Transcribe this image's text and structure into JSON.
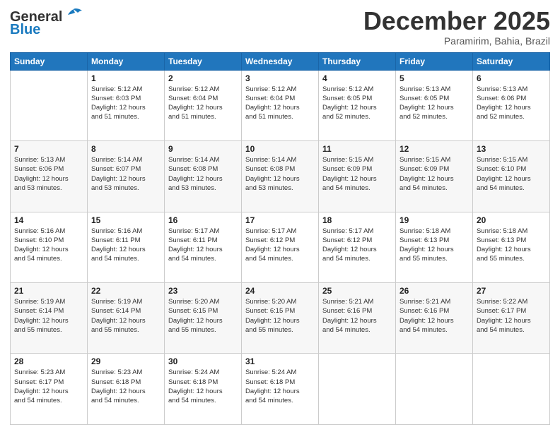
{
  "header": {
    "logo_general": "General",
    "logo_blue": "Blue",
    "month": "December 2025",
    "location": "Paramirim, Bahia, Brazil"
  },
  "weekdays": [
    "Sunday",
    "Monday",
    "Tuesday",
    "Wednesday",
    "Thursday",
    "Friday",
    "Saturday"
  ],
  "weeks": [
    [
      {
        "day": "",
        "info": ""
      },
      {
        "day": "1",
        "info": "Sunrise: 5:12 AM\nSunset: 6:03 PM\nDaylight: 12 hours\nand 51 minutes."
      },
      {
        "day": "2",
        "info": "Sunrise: 5:12 AM\nSunset: 6:04 PM\nDaylight: 12 hours\nand 51 minutes."
      },
      {
        "day": "3",
        "info": "Sunrise: 5:12 AM\nSunset: 6:04 PM\nDaylight: 12 hours\nand 51 minutes."
      },
      {
        "day": "4",
        "info": "Sunrise: 5:12 AM\nSunset: 6:05 PM\nDaylight: 12 hours\nand 52 minutes."
      },
      {
        "day": "5",
        "info": "Sunrise: 5:13 AM\nSunset: 6:05 PM\nDaylight: 12 hours\nand 52 minutes."
      },
      {
        "day": "6",
        "info": "Sunrise: 5:13 AM\nSunset: 6:06 PM\nDaylight: 12 hours\nand 52 minutes."
      }
    ],
    [
      {
        "day": "7",
        "info": "Sunrise: 5:13 AM\nSunset: 6:06 PM\nDaylight: 12 hours\nand 53 minutes."
      },
      {
        "day": "8",
        "info": "Sunrise: 5:14 AM\nSunset: 6:07 PM\nDaylight: 12 hours\nand 53 minutes."
      },
      {
        "day": "9",
        "info": "Sunrise: 5:14 AM\nSunset: 6:08 PM\nDaylight: 12 hours\nand 53 minutes."
      },
      {
        "day": "10",
        "info": "Sunrise: 5:14 AM\nSunset: 6:08 PM\nDaylight: 12 hours\nand 53 minutes."
      },
      {
        "day": "11",
        "info": "Sunrise: 5:15 AM\nSunset: 6:09 PM\nDaylight: 12 hours\nand 54 minutes."
      },
      {
        "day": "12",
        "info": "Sunrise: 5:15 AM\nSunset: 6:09 PM\nDaylight: 12 hours\nand 54 minutes."
      },
      {
        "day": "13",
        "info": "Sunrise: 5:15 AM\nSunset: 6:10 PM\nDaylight: 12 hours\nand 54 minutes."
      }
    ],
    [
      {
        "day": "14",
        "info": "Sunrise: 5:16 AM\nSunset: 6:10 PM\nDaylight: 12 hours\nand 54 minutes."
      },
      {
        "day": "15",
        "info": "Sunrise: 5:16 AM\nSunset: 6:11 PM\nDaylight: 12 hours\nand 54 minutes."
      },
      {
        "day": "16",
        "info": "Sunrise: 5:17 AM\nSunset: 6:11 PM\nDaylight: 12 hours\nand 54 minutes."
      },
      {
        "day": "17",
        "info": "Sunrise: 5:17 AM\nSunset: 6:12 PM\nDaylight: 12 hours\nand 54 minutes."
      },
      {
        "day": "18",
        "info": "Sunrise: 5:17 AM\nSunset: 6:12 PM\nDaylight: 12 hours\nand 54 minutes."
      },
      {
        "day": "19",
        "info": "Sunrise: 5:18 AM\nSunset: 6:13 PM\nDaylight: 12 hours\nand 55 minutes."
      },
      {
        "day": "20",
        "info": "Sunrise: 5:18 AM\nSunset: 6:13 PM\nDaylight: 12 hours\nand 55 minutes."
      }
    ],
    [
      {
        "day": "21",
        "info": "Sunrise: 5:19 AM\nSunset: 6:14 PM\nDaylight: 12 hours\nand 55 minutes."
      },
      {
        "day": "22",
        "info": "Sunrise: 5:19 AM\nSunset: 6:14 PM\nDaylight: 12 hours\nand 55 minutes."
      },
      {
        "day": "23",
        "info": "Sunrise: 5:20 AM\nSunset: 6:15 PM\nDaylight: 12 hours\nand 55 minutes."
      },
      {
        "day": "24",
        "info": "Sunrise: 5:20 AM\nSunset: 6:15 PM\nDaylight: 12 hours\nand 55 minutes."
      },
      {
        "day": "25",
        "info": "Sunrise: 5:21 AM\nSunset: 6:16 PM\nDaylight: 12 hours\nand 54 minutes."
      },
      {
        "day": "26",
        "info": "Sunrise: 5:21 AM\nSunset: 6:16 PM\nDaylight: 12 hours\nand 54 minutes."
      },
      {
        "day": "27",
        "info": "Sunrise: 5:22 AM\nSunset: 6:17 PM\nDaylight: 12 hours\nand 54 minutes."
      }
    ],
    [
      {
        "day": "28",
        "info": "Sunrise: 5:23 AM\nSunset: 6:17 PM\nDaylight: 12 hours\nand 54 minutes."
      },
      {
        "day": "29",
        "info": "Sunrise: 5:23 AM\nSunset: 6:18 PM\nDaylight: 12 hours\nand 54 minutes."
      },
      {
        "day": "30",
        "info": "Sunrise: 5:24 AM\nSunset: 6:18 PM\nDaylight: 12 hours\nand 54 minutes."
      },
      {
        "day": "31",
        "info": "Sunrise: 5:24 AM\nSunset: 6:18 PM\nDaylight: 12 hours\nand 54 minutes."
      },
      {
        "day": "",
        "info": ""
      },
      {
        "day": "",
        "info": ""
      },
      {
        "day": "",
        "info": ""
      }
    ]
  ]
}
